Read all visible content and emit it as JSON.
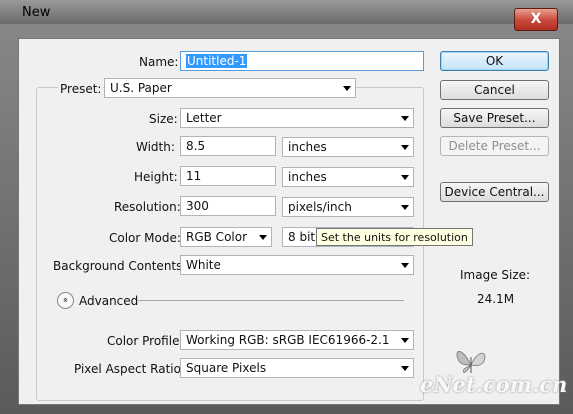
{
  "window": {
    "title": "New",
    "close_symbol": "X"
  },
  "name": {
    "label": "Name:",
    "value": "Untitled-1"
  },
  "preset": {
    "label": "Preset:",
    "value": "U.S. Paper"
  },
  "size": {
    "label": "Size:",
    "value": "Letter"
  },
  "width": {
    "label": "Width:",
    "value": "8.5",
    "unit": "inches"
  },
  "height": {
    "label": "Height:",
    "value": "11",
    "unit": "inches"
  },
  "resolution": {
    "label": "Resolution:",
    "value": "300",
    "unit": "pixels/inch"
  },
  "color_mode": {
    "label": "Color Mode:",
    "value": "RGB Color",
    "bits": "8 bit"
  },
  "tooltip": "Set the units for resolution",
  "background": {
    "label": "Background Contents:",
    "value": "White"
  },
  "advanced": {
    "label": "Advanced",
    "symbol": "»"
  },
  "color_profile": {
    "label": "Color Profile:",
    "value": "Working RGB:  sRGB IEC61966-2.1"
  },
  "pixel_aspect": {
    "label": "Pixel Aspect Ratio:",
    "value": "Square Pixels"
  },
  "buttons": {
    "ok": "OK",
    "cancel": "Cancel",
    "save_preset": "Save Preset...",
    "delete_preset": "Delete Preset...",
    "device_central": "Device Central..."
  },
  "image_size": {
    "label": "Image Size:",
    "value": "24.1M"
  },
  "watermark": "eNet.com.cn"
}
